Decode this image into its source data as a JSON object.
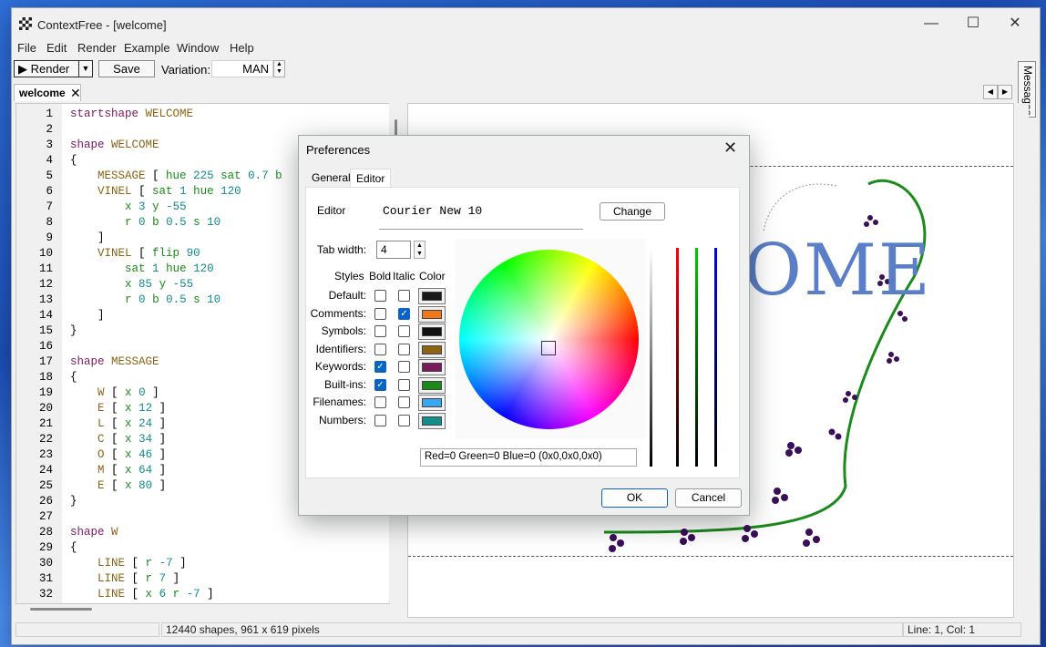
{
  "window": {
    "title": "ContextFree - [welcome]"
  },
  "menu": [
    "File",
    "Edit",
    "Render",
    "Example",
    "Window",
    "Help"
  ],
  "toolbar": {
    "render_label": "Render",
    "save_label": "Save",
    "variation_label": "Variation:",
    "variation_value": "MAN"
  },
  "side_tab": {
    "messages_label": "Messages"
  },
  "doc_tab": {
    "label": "welcome"
  },
  "editor": {
    "lines": [
      [
        [
          "kw",
          "startshape"
        ],
        [
          "t",
          " "
        ],
        [
          "id",
          "WELCOME"
        ]
      ],
      [],
      [
        [
          "kw",
          "shape"
        ],
        [
          "t",
          " "
        ],
        [
          "id",
          "WELCOME"
        ]
      ],
      [
        [
          "t",
          "{"
        ]
      ],
      [
        [
          "t",
          "    "
        ],
        [
          "id",
          "MESSAGE"
        ],
        [
          "t",
          " [ "
        ],
        [
          "bi",
          "hue"
        ],
        [
          "t",
          " "
        ],
        [
          "num",
          "225"
        ],
        [
          "t",
          " "
        ],
        [
          "bi",
          "sat"
        ],
        [
          "t",
          " "
        ],
        [
          "num",
          "0.7"
        ],
        [
          "t",
          " "
        ],
        [
          "bi",
          "b"
        ]
      ],
      [
        [
          "t",
          "    "
        ],
        [
          "id",
          "VINEL"
        ],
        [
          "t",
          " [ "
        ],
        [
          "bi",
          "sat"
        ],
        [
          "t",
          " "
        ],
        [
          "num",
          "1"
        ],
        [
          "t",
          " "
        ],
        [
          "bi",
          "hue"
        ],
        [
          "t",
          " "
        ],
        [
          "num",
          "120"
        ]
      ],
      [
        [
          "t",
          "        "
        ],
        [
          "bi",
          "x"
        ],
        [
          "t",
          " "
        ],
        [
          "num",
          "3"
        ],
        [
          "t",
          " "
        ],
        [
          "bi",
          "y"
        ],
        [
          "t",
          " "
        ],
        [
          "num",
          "-55"
        ]
      ],
      [
        [
          "t",
          "        "
        ],
        [
          "bi",
          "r"
        ],
        [
          "t",
          " "
        ],
        [
          "num",
          "0"
        ],
        [
          "t",
          " "
        ],
        [
          "bi",
          "b"
        ],
        [
          "t",
          " "
        ],
        [
          "num",
          "0.5"
        ],
        [
          "t",
          " "
        ],
        [
          "bi",
          "s"
        ],
        [
          "t",
          " "
        ],
        [
          "num",
          "10"
        ]
      ],
      [
        [
          "t",
          "    ]"
        ]
      ],
      [
        [
          "t",
          "    "
        ],
        [
          "id",
          "VINEL"
        ],
        [
          "t",
          " [ "
        ],
        [
          "bi",
          "flip"
        ],
        [
          "t",
          " "
        ],
        [
          "num",
          "90"
        ]
      ],
      [
        [
          "t",
          "        "
        ],
        [
          "bi",
          "sat"
        ],
        [
          "t",
          " "
        ],
        [
          "num",
          "1"
        ],
        [
          "t",
          " "
        ],
        [
          "bi",
          "hue"
        ],
        [
          "t",
          " "
        ],
        [
          "num",
          "120"
        ]
      ],
      [
        [
          "t",
          "        "
        ],
        [
          "bi",
          "x"
        ],
        [
          "t",
          " "
        ],
        [
          "num",
          "85"
        ],
        [
          "t",
          " "
        ],
        [
          "bi",
          "y"
        ],
        [
          "t",
          " "
        ],
        [
          "num",
          "-55"
        ]
      ],
      [
        [
          "t",
          "        "
        ],
        [
          "bi",
          "r"
        ],
        [
          "t",
          " "
        ],
        [
          "num",
          "0"
        ],
        [
          "t",
          " "
        ],
        [
          "bi",
          "b"
        ],
        [
          "t",
          " "
        ],
        [
          "num",
          "0.5"
        ],
        [
          "t",
          " "
        ],
        [
          "bi",
          "s"
        ],
        [
          "t",
          " "
        ],
        [
          "num",
          "10"
        ]
      ],
      [
        [
          "t",
          "    ]"
        ]
      ],
      [
        [
          "t",
          "}"
        ]
      ],
      [],
      [
        [
          "kw",
          "shape"
        ],
        [
          "t",
          " "
        ],
        [
          "id",
          "MESSAGE"
        ]
      ],
      [
        [
          "t",
          "{"
        ]
      ],
      [
        [
          "t",
          "    "
        ],
        [
          "id",
          "W"
        ],
        [
          "t",
          " [ "
        ],
        [
          "bi",
          "x"
        ],
        [
          "t",
          " "
        ],
        [
          "num",
          "0"
        ],
        [
          "t",
          " ]"
        ]
      ],
      [
        [
          "t",
          "    "
        ],
        [
          "id",
          "E"
        ],
        [
          "t",
          " [ "
        ],
        [
          "bi",
          "x"
        ],
        [
          "t",
          " "
        ],
        [
          "num",
          "12"
        ],
        [
          "t",
          " ]"
        ]
      ],
      [
        [
          "t",
          "    "
        ],
        [
          "id",
          "L"
        ],
        [
          "t",
          " [ "
        ],
        [
          "bi",
          "x"
        ],
        [
          "t",
          " "
        ],
        [
          "num",
          "24"
        ],
        [
          "t",
          " ]"
        ]
      ],
      [
        [
          "t",
          "    "
        ],
        [
          "id",
          "C"
        ],
        [
          "t",
          " [ "
        ],
        [
          "bi",
          "x"
        ],
        [
          "t",
          " "
        ],
        [
          "num",
          "34"
        ],
        [
          "t",
          " ]"
        ]
      ],
      [
        [
          "t",
          "    "
        ],
        [
          "id",
          "O"
        ],
        [
          "t",
          " [ "
        ],
        [
          "bi",
          "x"
        ],
        [
          "t",
          " "
        ],
        [
          "num",
          "46"
        ],
        [
          "t",
          " ]"
        ]
      ],
      [
        [
          "t",
          "    "
        ],
        [
          "id",
          "M"
        ],
        [
          "t",
          " [ "
        ],
        [
          "bi",
          "x"
        ],
        [
          "t",
          " "
        ],
        [
          "num",
          "64"
        ],
        [
          "t",
          " ]"
        ]
      ],
      [
        [
          "t",
          "    "
        ],
        [
          "id",
          "E"
        ],
        [
          "t",
          " [ "
        ],
        [
          "bi",
          "x"
        ],
        [
          "t",
          " "
        ],
        [
          "num",
          "80"
        ],
        [
          "t",
          " ]"
        ]
      ],
      [
        [
          "t",
          "}"
        ]
      ],
      [],
      [
        [
          "kw",
          "shape"
        ],
        [
          "t",
          " "
        ],
        [
          "id",
          "W"
        ]
      ],
      [
        [
          "t",
          "{"
        ]
      ],
      [
        [
          "t",
          "    "
        ],
        [
          "id",
          "LINE"
        ],
        [
          "t",
          " [ "
        ],
        [
          "bi",
          "r"
        ],
        [
          "t",
          " "
        ],
        [
          "num",
          "-7"
        ],
        [
          "t",
          " ]"
        ]
      ],
      [
        [
          "t",
          "    "
        ],
        [
          "id",
          "LINE"
        ],
        [
          "t",
          " [ "
        ],
        [
          "bi",
          "r"
        ],
        [
          "t",
          " "
        ],
        [
          "num",
          "7"
        ],
        [
          "t",
          " ]"
        ]
      ],
      [
        [
          "t",
          "    "
        ],
        [
          "id",
          "LINE"
        ],
        [
          "t",
          " [ "
        ],
        [
          "bi",
          "x"
        ],
        [
          "t",
          " "
        ],
        [
          "num",
          "6"
        ],
        [
          "t",
          " "
        ],
        [
          "bi",
          "r"
        ],
        [
          "t",
          " "
        ],
        [
          "num",
          "-7"
        ],
        [
          "t",
          " ]"
        ]
      ]
    ]
  },
  "render": {
    "visible_text": "OME"
  },
  "status": {
    "shapes": "12440 shapes, 961 x 619 pixels",
    "position": "Line: 1, Col: 1"
  },
  "dialog": {
    "title": "Preferences",
    "tabs": [
      "General",
      "Editor"
    ],
    "editor_label": "Editor",
    "font_value": "Courier New 10",
    "change_label": "Change",
    "tab_width_label": "Tab width:",
    "tab_width_value": "4",
    "headers": {
      "styles": "Styles",
      "bold": "Bold",
      "italic": "Italic",
      "color": "Color"
    },
    "styles": [
      {
        "label": "Default:",
        "bold": false,
        "italic": false,
        "color": "#1a1a1a"
      },
      {
        "label": "Comments:",
        "bold": false,
        "italic": true,
        "color": "#f07818"
      },
      {
        "label": "Symbols:",
        "bold": false,
        "italic": false,
        "color": "#111111"
      },
      {
        "label": "Identifiers:",
        "bold": false,
        "italic": false,
        "color": "#8a6414"
      },
      {
        "label": "Keywords:",
        "bold": true,
        "italic": false,
        "color": "#7a1a5c"
      },
      {
        "label": "Built-ins:",
        "bold": true,
        "italic": false,
        "color": "#1a8a1a"
      },
      {
        "label": "Filenames:",
        "bold": false,
        "italic": false,
        "color": "#3aa6f0"
      },
      {
        "label": "Numbers:",
        "bold": false,
        "italic": false,
        "color": "#138c8c"
      }
    ],
    "rgb_text": "Red=0 Green=0 Blue=0 (0x0,0x0,0x0)",
    "ok_label": "OK",
    "cancel_label": "Cancel"
  },
  "colors": {
    "keyword": "#7a1a5c",
    "builtin": "#1a8a1a",
    "identifier": "#8a6414",
    "number": "#138c8c",
    "accent": "#0b63c5"
  }
}
